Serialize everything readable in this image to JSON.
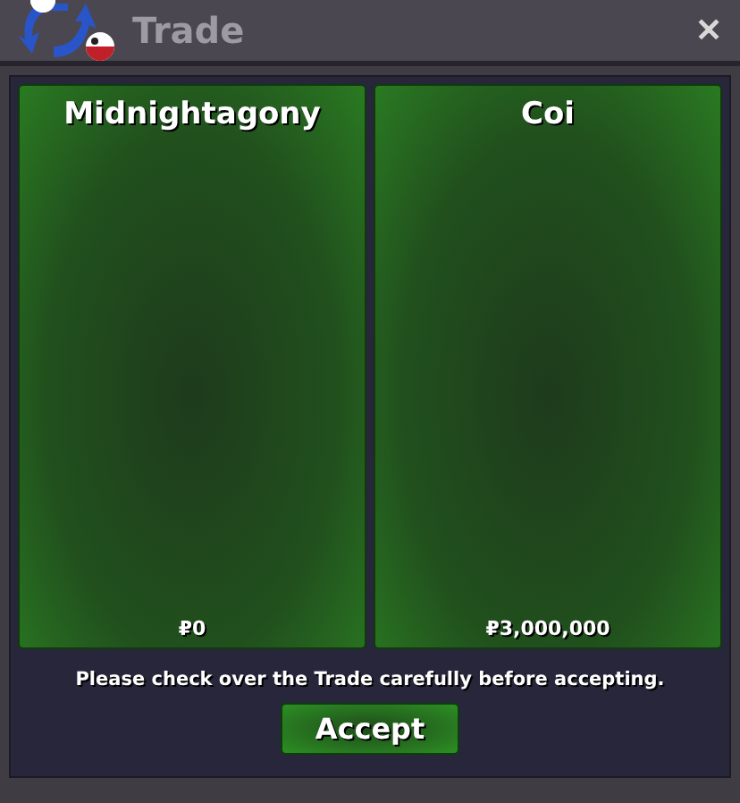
{
  "window": {
    "title": "Trade",
    "close": "✕"
  },
  "offers": [
    {
      "name": "Midnightagony",
      "money": "₽0"
    },
    {
      "name": "Coi",
      "money": "₽3,000,000"
    }
  ],
  "notice": "Please check over the Trade carefully before accepting.",
  "buttons": [
    "Accept"
  ]
}
